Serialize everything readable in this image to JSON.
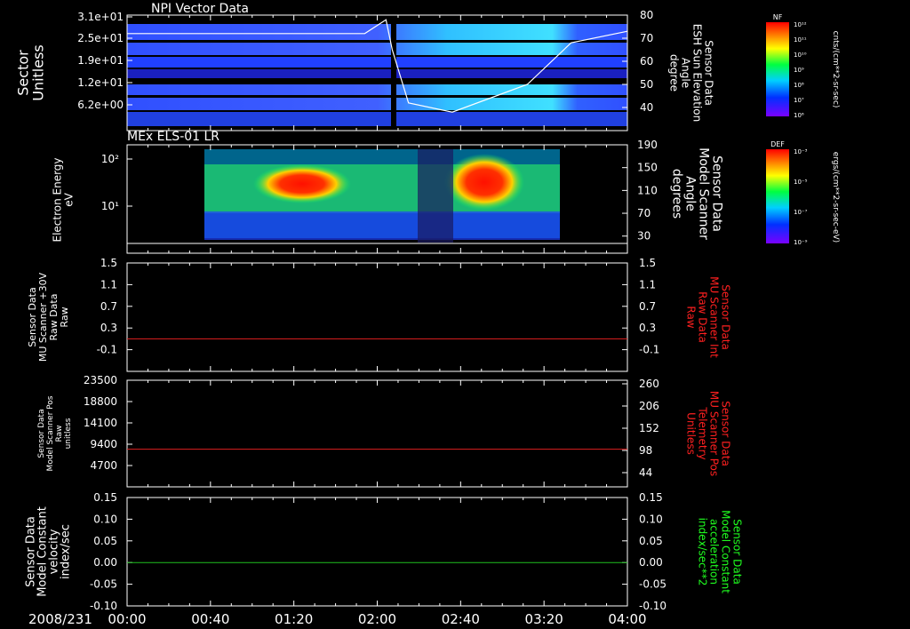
{
  "footer": {
    "date": "2008/231",
    "x_ticks": [
      "00:00",
      "00:40",
      "01:20",
      "02:00",
      "02:40",
      "03:20",
      "04:00"
    ]
  },
  "colors": {
    "red_trace": "#e02020",
    "green_trace": "#20c020",
    "white": "#ffffff",
    "red_label": "#ff2020",
    "green_label": "#20ff20"
  },
  "colorbars": {
    "nf": {
      "title": "NF",
      "unit": "cnts/(cm**2-sr-sec)",
      "ticks": [
        "10¹²",
        "10¹¹",
        "10¹⁰",
        "10⁹",
        "10⁸",
        "10⁷",
        "10⁶"
      ]
    },
    "def": {
      "title": "DEF",
      "unit": "ergs/(cm**2-sr-sec-eV)",
      "ticks": [
        "10⁻³",
        "10⁻⁵",
        "10⁻⁷",
        "10⁻⁹"
      ]
    }
  },
  "chart_data": [
    {
      "type": "heatmap",
      "title": "NPI Vector Data",
      "ylabel": [
        "Sector",
        "Unitless"
      ],
      "y_ticks": [
        "3.1e+01",
        "2.5e+01",
        "1.9e+01",
        "1.2e+01",
        "6.2e+00"
      ],
      "y2label": [
        "Sensor Data",
        "ESH Sun Elevation",
        "Angle",
        "degree"
      ],
      "y2_ticks": [
        80,
        70,
        60,
        50,
        40
      ],
      "y2lim": [
        30,
        80
      ],
      "overlay_line": {
        "x_hours": [
          0,
          1.9,
          2.07,
          2.12,
          2.25,
          2.6,
          2.95,
          3.2,
          3.55,
          4.0
        ],
        "y_deg": [
          72,
          72,
          78,
          65,
          42,
          38,
          45,
          50,
          68,
          73
        ]
      }
    },
    {
      "type": "heatmap",
      "title": "MEx ELS-01 LR",
      "ylabel": [
        "Electron Energy",
        "eV"
      ],
      "y_ticks": [
        "10²",
        "10¹"
      ],
      "y2label": [
        "Sensor Data",
        "Model Scanner",
        "Angle",
        "degrees"
      ],
      "y2_ticks": [
        190,
        150,
        110,
        70,
        30
      ],
      "y2lim": [
        0,
        190
      ],
      "overlay_line": {
        "x_hours": [
          0,
          4.0
        ],
        "y_deg": [
          12,
          12
        ]
      }
    },
    {
      "type": "line",
      "ylabel": [
        "Sensor Data",
        "MU Scanner +30V",
        "Raw Data",
        "Raw"
      ],
      "y_ticks": [
        1.5,
        1.1,
        0.7,
        0.3,
        -0.1
      ],
      "y2label": [
        "Sensor Data",
        "MU Scanner Int",
        "Raw Data",
        "Raw"
      ],
      "y2_ticks": [
        1.5,
        1.1,
        0.7,
        0.3,
        -0.1
      ],
      "ylim": [
        -0.5,
        1.5
      ],
      "series": [
        {
          "color": "#e02020",
          "x_hours": [
            0,
            4.0
          ],
          "values": [
            0.1,
            0.1
          ]
        }
      ]
    },
    {
      "type": "line",
      "ylabel": [
        "Sensor Data",
        "Model Scanner Pos",
        "Raw",
        "unitless"
      ],
      "y_ticks": [
        23500,
        18800,
        14100,
        9400,
        4700
      ],
      "y2label": [
        "Sensor Data",
        "MU Scanner Pos",
        "Telemetry",
        "Unitless"
      ],
      "y2_ticks": [
        260,
        206,
        152,
        98,
        44
      ],
      "ylim": [
        0,
        23500
      ],
      "series": [
        {
          "color": "#e02020",
          "x_hours": [
            0,
            4.0
          ],
          "values": [
            8300,
            8300
          ]
        }
      ]
    },
    {
      "type": "line",
      "ylabel": [
        "Sensor Data",
        "Model Constant",
        "velocity",
        "index/sec"
      ],
      "y_ticks": [
        "0.15",
        "0.10",
        "0.05",
        "0.00",
        "-0.05",
        "-0.10"
      ],
      "y2label": [
        "Sensor Data",
        "Model Constant",
        "acceleration",
        "index/sec**2"
      ],
      "y2_ticks": [
        "0.15",
        "0.10",
        "0.05",
        "0.00",
        "-0.05",
        "-0.10"
      ],
      "ylim": [
        -0.1,
        0.15
      ],
      "series": [
        {
          "color": "#20c020",
          "x_hours": [
            0,
            4.0
          ],
          "values": [
            0,
            0
          ]
        }
      ]
    }
  ]
}
